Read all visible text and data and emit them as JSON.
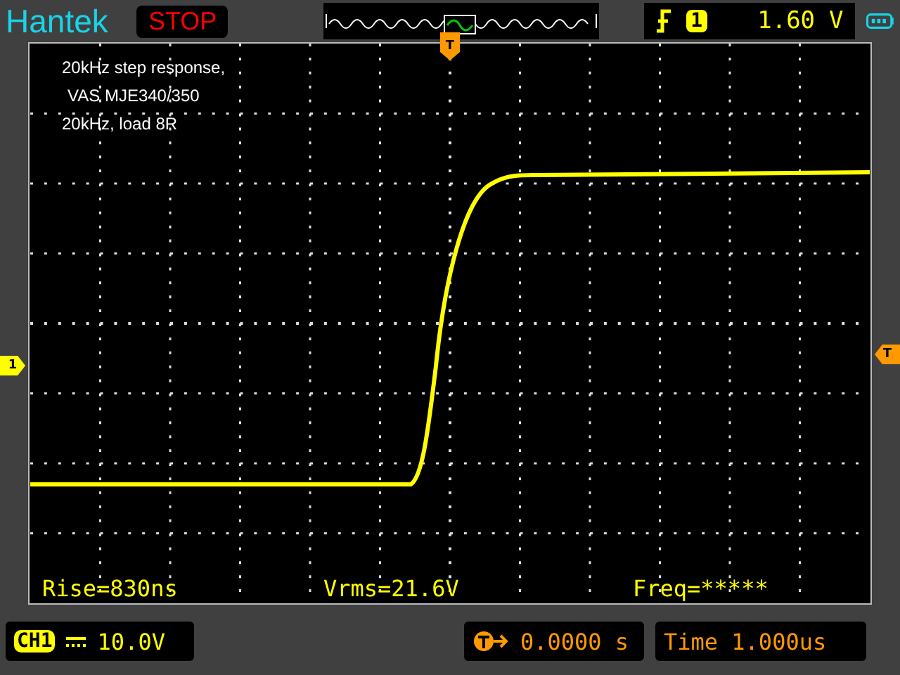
{
  "header": {
    "brand": "Hantek",
    "run_state": "STOP",
    "trigger": {
      "source": "1",
      "level": "1.60",
      "unit": "V"
    }
  },
  "annotation": [
    "20kHz step response,",
    "VAS MJE340/350",
    "20kHz, load 8R"
  ],
  "markers": {
    "channel": "1",
    "trigger_time": "T",
    "trigger_level": "T"
  },
  "measurements": [
    "Rise=830ns",
    "Vrms=21.6V",
    "Freq=*****"
  ],
  "footer": {
    "channel": "CH1",
    "volts_per_div": "10.0V",
    "trigger_offset": "0.0000 s",
    "timebase": "Time 1.000us"
  }
}
